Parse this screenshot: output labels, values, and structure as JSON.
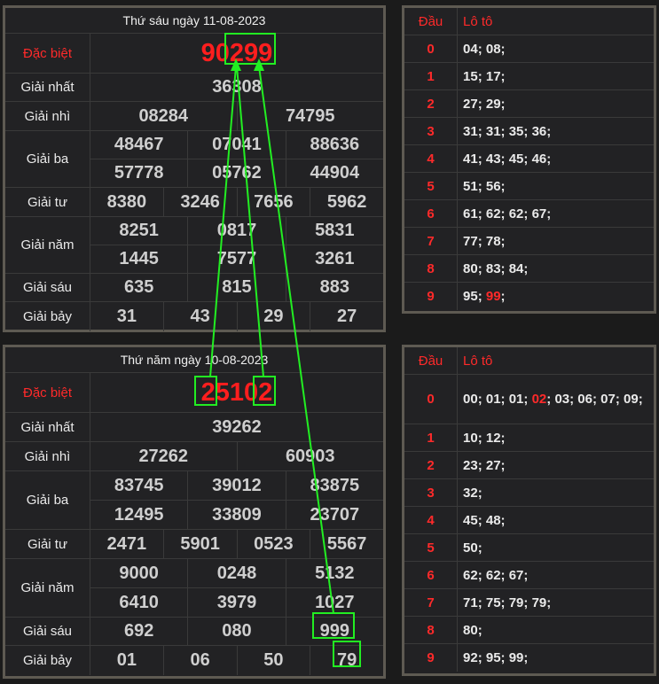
{
  "results": [
    {
      "date_title": "Thứ sáu ngày 11-08-2023",
      "labels": [
        "Đặc biệt",
        "Giải nhất",
        "Giải nhì",
        "Giải ba",
        "Giải tư",
        "Giải năm",
        "Giải sáu",
        "Giải bảy"
      ],
      "special": "90299",
      "first": "36308",
      "second": [
        "08284",
        "74795"
      ],
      "third": [
        "48467",
        "07041",
        "88636",
        "57778",
        "05762",
        "44904"
      ],
      "fourth": [
        "8380",
        "3246",
        "7656",
        "5962"
      ],
      "fifth": [
        "8251",
        "0817",
        "5831",
        "1445",
        "7577",
        "3261"
      ],
      "sixth": [
        "635",
        "815",
        "883"
      ],
      "seventh": [
        "31",
        "43",
        "29",
        "27"
      ]
    },
    {
      "date_title": "Thứ năm ngày 10-08-2023",
      "labels": [
        "Đặc biệt",
        "Giải nhất",
        "Giải nhì",
        "Giải ba",
        "Giải tư",
        "Giải năm",
        "Giải sáu",
        "Giải bảy"
      ],
      "special": "25102",
      "first": "39262",
      "second": [
        "27262",
        "60903"
      ],
      "third": [
        "83745",
        "39012",
        "83875",
        "12495",
        "33809",
        "23707"
      ],
      "fourth": [
        "2471",
        "5901",
        "0523",
        "5567"
      ],
      "fifth": [
        "9000",
        "0248",
        "5132",
        "6410",
        "3979",
        "1027"
      ],
      "sixth": [
        "692",
        "080",
        "999"
      ],
      "seventh": [
        "01",
        "06",
        "50",
        "79"
      ]
    }
  ],
  "loto": [
    {
      "head_dau": "Đầu",
      "head_loto": "Lô tô",
      "rows": [
        {
          "dau": "0",
          "items": [
            "04",
            "08"
          ]
        },
        {
          "dau": "1",
          "items": [
            "15",
            "17"
          ]
        },
        {
          "dau": "2",
          "items": [
            "27",
            "29"
          ]
        },
        {
          "dau": "3",
          "items": [
            "31",
            "31",
            "35",
            "36"
          ]
        },
        {
          "dau": "4",
          "items": [
            "41",
            "43",
            "45",
            "46"
          ]
        },
        {
          "dau": "5",
          "items": [
            "51",
            "56"
          ]
        },
        {
          "dau": "6",
          "items": [
            "61",
            "62",
            "62",
            "67"
          ]
        },
        {
          "dau": "7",
          "items": [
            "77",
            "78"
          ]
        },
        {
          "dau": "8",
          "items": [
            "80",
            "83",
            "84"
          ]
        },
        {
          "dau": "9",
          "items": [
            "95",
            "99"
          ],
          "highlight": [
            "99"
          ]
        }
      ]
    },
    {
      "head_dau": "Đầu",
      "head_loto": "Lô tô",
      "rows": [
        {
          "dau": "0",
          "items": [
            "00",
            "01",
            "01",
            "02",
            "03",
            "06",
            "07",
            "09"
          ],
          "highlight": [
            "02"
          ]
        },
        {
          "dau": "1",
          "items": [
            "10",
            "12"
          ]
        },
        {
          "dau": "2",
          "items": [
            "23",
            "27"
          ]
        },
        {
          "dau": "3",
          "items": [
            "32"
          ]
        },
        {
          "dau": "4",
          "items": [
            "45",
            "48"
          ]
        },
        {
          "dau": "5",
          "items": [
            "50"
          ]
        },
        {
          "dau": "6",
          "items": [
            "62",
            "62",
            "67"
          ]
        },
        {
          "dau": "7",
          "items": [
            "71",
            "75",
            "79",
            "79"
          ]
        },
        {
          "dau": "8",
          "items": [
            "80"
          ]
        },
        {
          "dau": "9",
          "items": [
            "92",
            "95",
            "99"
          ]
        }
      ]
    }
  ],
  "colors": {
    "highlight_box": "#22ee22",
    "special": "#ff1e1e",
    "dau": "#ff2a2a"
  }
}
